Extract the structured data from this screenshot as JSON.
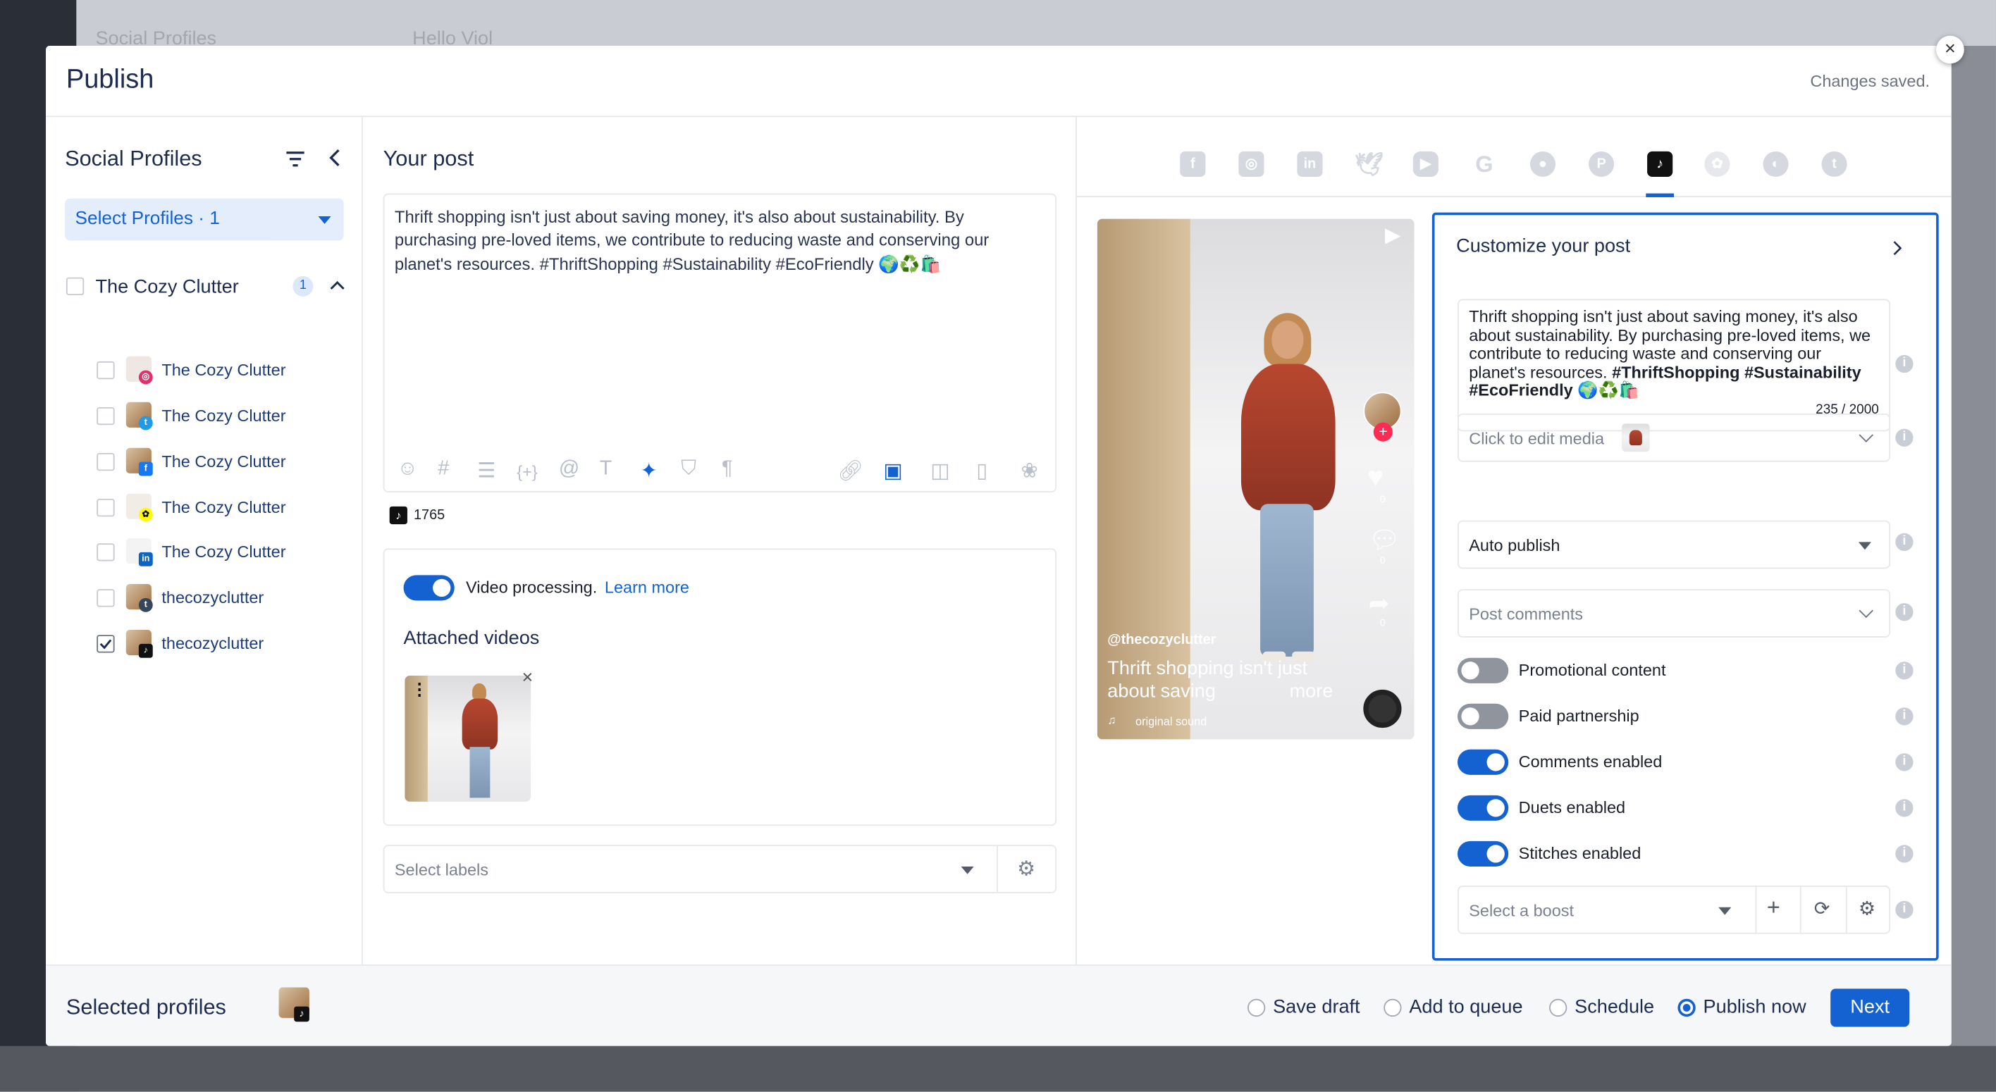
{
  "background": {
    "left_title": "Social Profiles",
    "right_title": "Hello Viol"
  },
  "modal": {
    "title": "Publish",
    "status": "Changes saved.",
    "close_icon": "×"
  },
  "profiles_panel": {
    "heading": "Social Profiles",
    "select_label": "Select Profiles · 1",
    "group": {
      "name": "The Cozy Clutter",
      "count": "1"
    },
    "items": [
      {
        "label": "The Cozy Clutter",
        "network": "instagram",
        "checked": false
      },
      {
        "label": "The Cozy Clutter",
        "network": "twitter",
        "checked": false
      },
      {
        "label": "The Cozy Clutter",
        "network": "facebook",
        "checked": false
      },
      {
        "label": "The Cozy Clutter",
        "network": "snapchat",
        "checked": false
      },
      {
        "label": "The Cozy Clutter",
        "network": "linkedin",
        "checked": false
      },
      {
        "label": "thecozyclutter",
        "network": "tumblr",
        "checked": false
      },
      {
        "label": "thecozyclutter",
        "network": "tiktok",
        "checked": true
      }
    ]
  },
  "post": {
    "heading": "Your post",
    "text": "Thrift shopping isn't just about saving money, it's also about sustainability. By purchasing pre-loved items, we contribute to reducing waste and conserving our planet's resources. #ThriftShopping #Sustainability #EcoFriendly 🌍♻️🛍️",
    "char_count": "1765",
    "video_processing_label": "Video processing.",
    "learn_more": "Learn more",
    "attached_heading": "Attached videos",
    "labels_placeholder": "Select labels"
  },
  "preview": {
    "username": "@thecozyclutter",
    "caption_line1": "Thrift shopping isn't just",
    "caption_line2": "about saving",
    "more": "more",
    "sound": "original sound",
    "counts": [
      "0",
      "0",
      "0"
    ]
  },
  "customize": {
    "heading": "Customize your post",
    "text_line1": "Thrift shopping isn't just about saving money, it's also about sustainability. By purchasing pre-loved items, we contribute to reducing waste and conserving our planet's resources.",
    "text_tags": "#ThriftShopping #Sustainability #EcoFriendly",
    "text_emoji": "🌍♻️🛍️",
    "counter": "235 / 2000",
    "media_label": "Click to edit media",
    "publish_mode": "Auto publish",
    "comments_label": "Post comments",
    "toggles": [
      {
        "label": "Promotional content",
        "on": false
      },
      {
        "label": "Paid partnership",
        "on": false
      },
      {
        "label": "Comments enabled",
        "on": true
      },
      {
        "label": "Duets enabled",
        "on": true
      },
      {
        "label": "Stitches enabled",
        "on": true
      }
    ],
    "boost_placeholder": "Select a boost"
  },
  "footer": {
    "selected_label": "Selected profiles",
    "options": [
      "Save draft",
      "Add to queue",
      "Schedule",
      "Publish now"
    ],
    "selected_option": "Publish now",
    "next_label": "Next"
  },
  "colors": {
    "accent": "#1462d2",
    "title": "#1d2b4f"
  }
}
